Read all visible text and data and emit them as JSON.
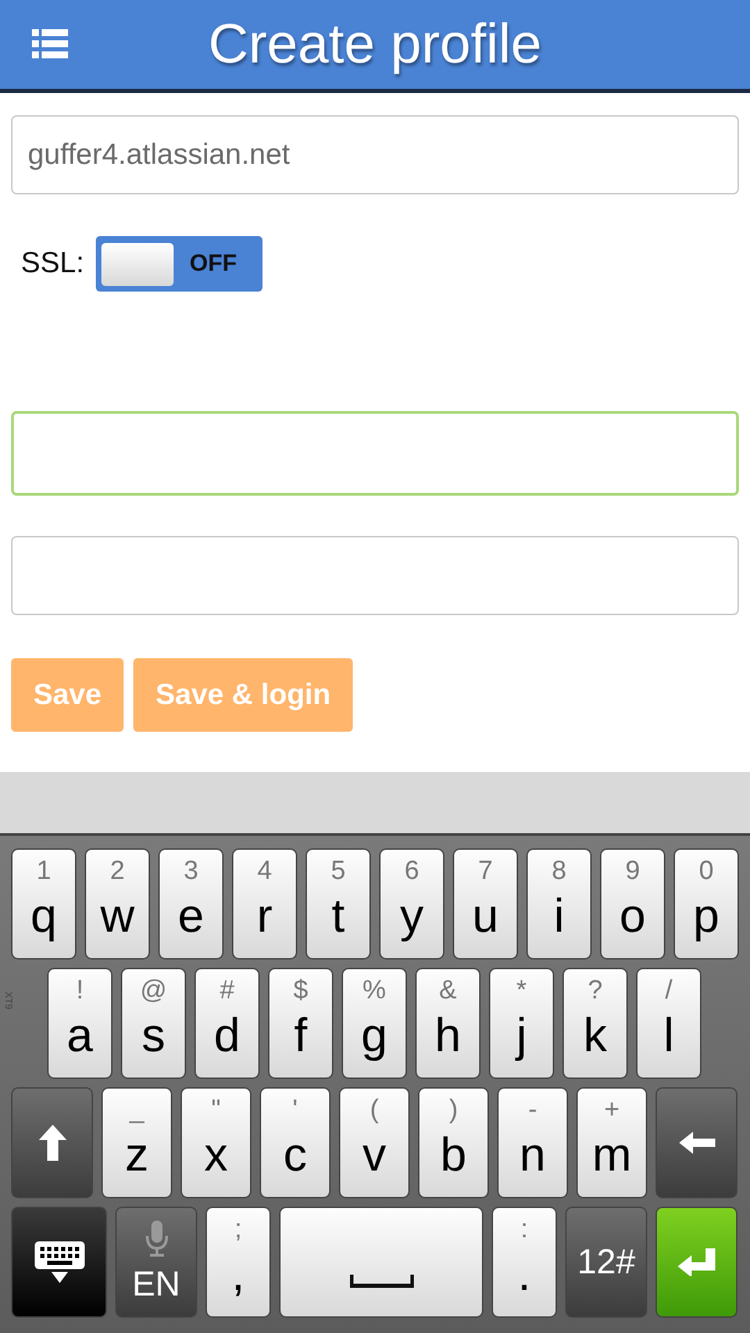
{
  "header": {
    "title": "Create profile"
  },
  "fields": [
    {
      "value": "guffer4.atlassian.net",
      "focused": false
    },
    {
      "focused": true
    },
    {
      "focused": false
    }
  ],
  "ssl": {
    "label": "SSL:",
    "on": false,
    "state_text": "OFF"
  },
  "buttons": [
    "Save",
    "Save & login"
  ],
  "keyboard": {
    "side_label": "XT9",
    "rows": [
      {
        "keys": [
          {
            "kind": "letter",
            "sub": "1",
            "main": "q"
          },
          {
            "kind": "letter",
            "sub": "2",
            "main": "w"
          },
          {
            "kind": "letter",
            "sub": "3",
            "main": "e"
          },
          {
            "kind": "letter",
            "sub": "4",
            "main": "r"
          },
          {
            "kind": "letter",
            "sub": "5",
            "main": "t"
          },
          {
            "kind": "letter",
            "sub": "6",
            "main": "y"
          },
          {
            "kind": "letter",
            "sub": "7",
            "main": "u"
          },
          {
            "kind": "letter",
            "sub": "8",
            "main": "i"
          },
          {
            "kind": "letter",
            "sub": "9",
            "main": "o"
          },
          {
            "kind": "letter",
            "sub": "0",
            "main": "p"
          }
        ]
      },
      {
        "keys": [
          {
            "kind": "letter",
            "sub": "!",
            "main": "a"
          },
          {
            "kind": "letter",
            "sub": "@",
            "main": "s"
          },
          {
            "kind": "letter",
            "sub": "#",
            "main": "d"
          },
          {
            "kind": "letter",
            "sub": "$",
            "main": "f"
          },
          {
            "kind": "letter",
            "sub": "%",
            "main": "g"
          },
          {
            "kind": "letter",
            "sub": "&",
            "main": "h"
          },
          {
            "kind": "letter",
            "sub": "*",
            "main": "j"
          },
          {
            "kind": "letter",
            "sub": "?",
            "main": "k"
          },
          {
            "kind": "letter",
            "sub": "/",
            "main": "l"
          }
        ]
      },
      {
        "keys": [
          {
            "kind": "shift"
          },
          {
            "kind": "letter",
            "sub": "_",
            "main": "z"
          },
          {
            "kind": "letter",
            "sub": "\"",
            "main": "x"
          },
          {
            "kind": "letter",
            "sub": "'",
            "main": "c"
          },
          {
            "kind": "letter",
            "sub": "(",
            "main": "v"
          },
          {
            "kind": "letter",
            "sub": ")",
            "main": "b"
          },
          {
            "kind": "letter",
            "sub": "-",
            "main": "n"
          },
          {
            "kind": "letter",
            "sub": "+",
            "main": "m"
          },
          {
            "kind": "backspace"
          }
        ]
      },
      {
        "keys": [
          {
            "kind": "hide"
          },
          {
            "kind": "language",
            "main": "EN"
          },
          {
            "kind": "letter",
            "sub": ";",
            "main": ","
          },
          {
            "kind": "space"
          },
          {
            "kind": "letter",
            "sub": ":",
            "main": "."
          },
          {
            "kind": "symbols",
            "main": "12#"
          },
          {
            "kind": "enter"
          }
        ]
      }
    ]
  }
}
